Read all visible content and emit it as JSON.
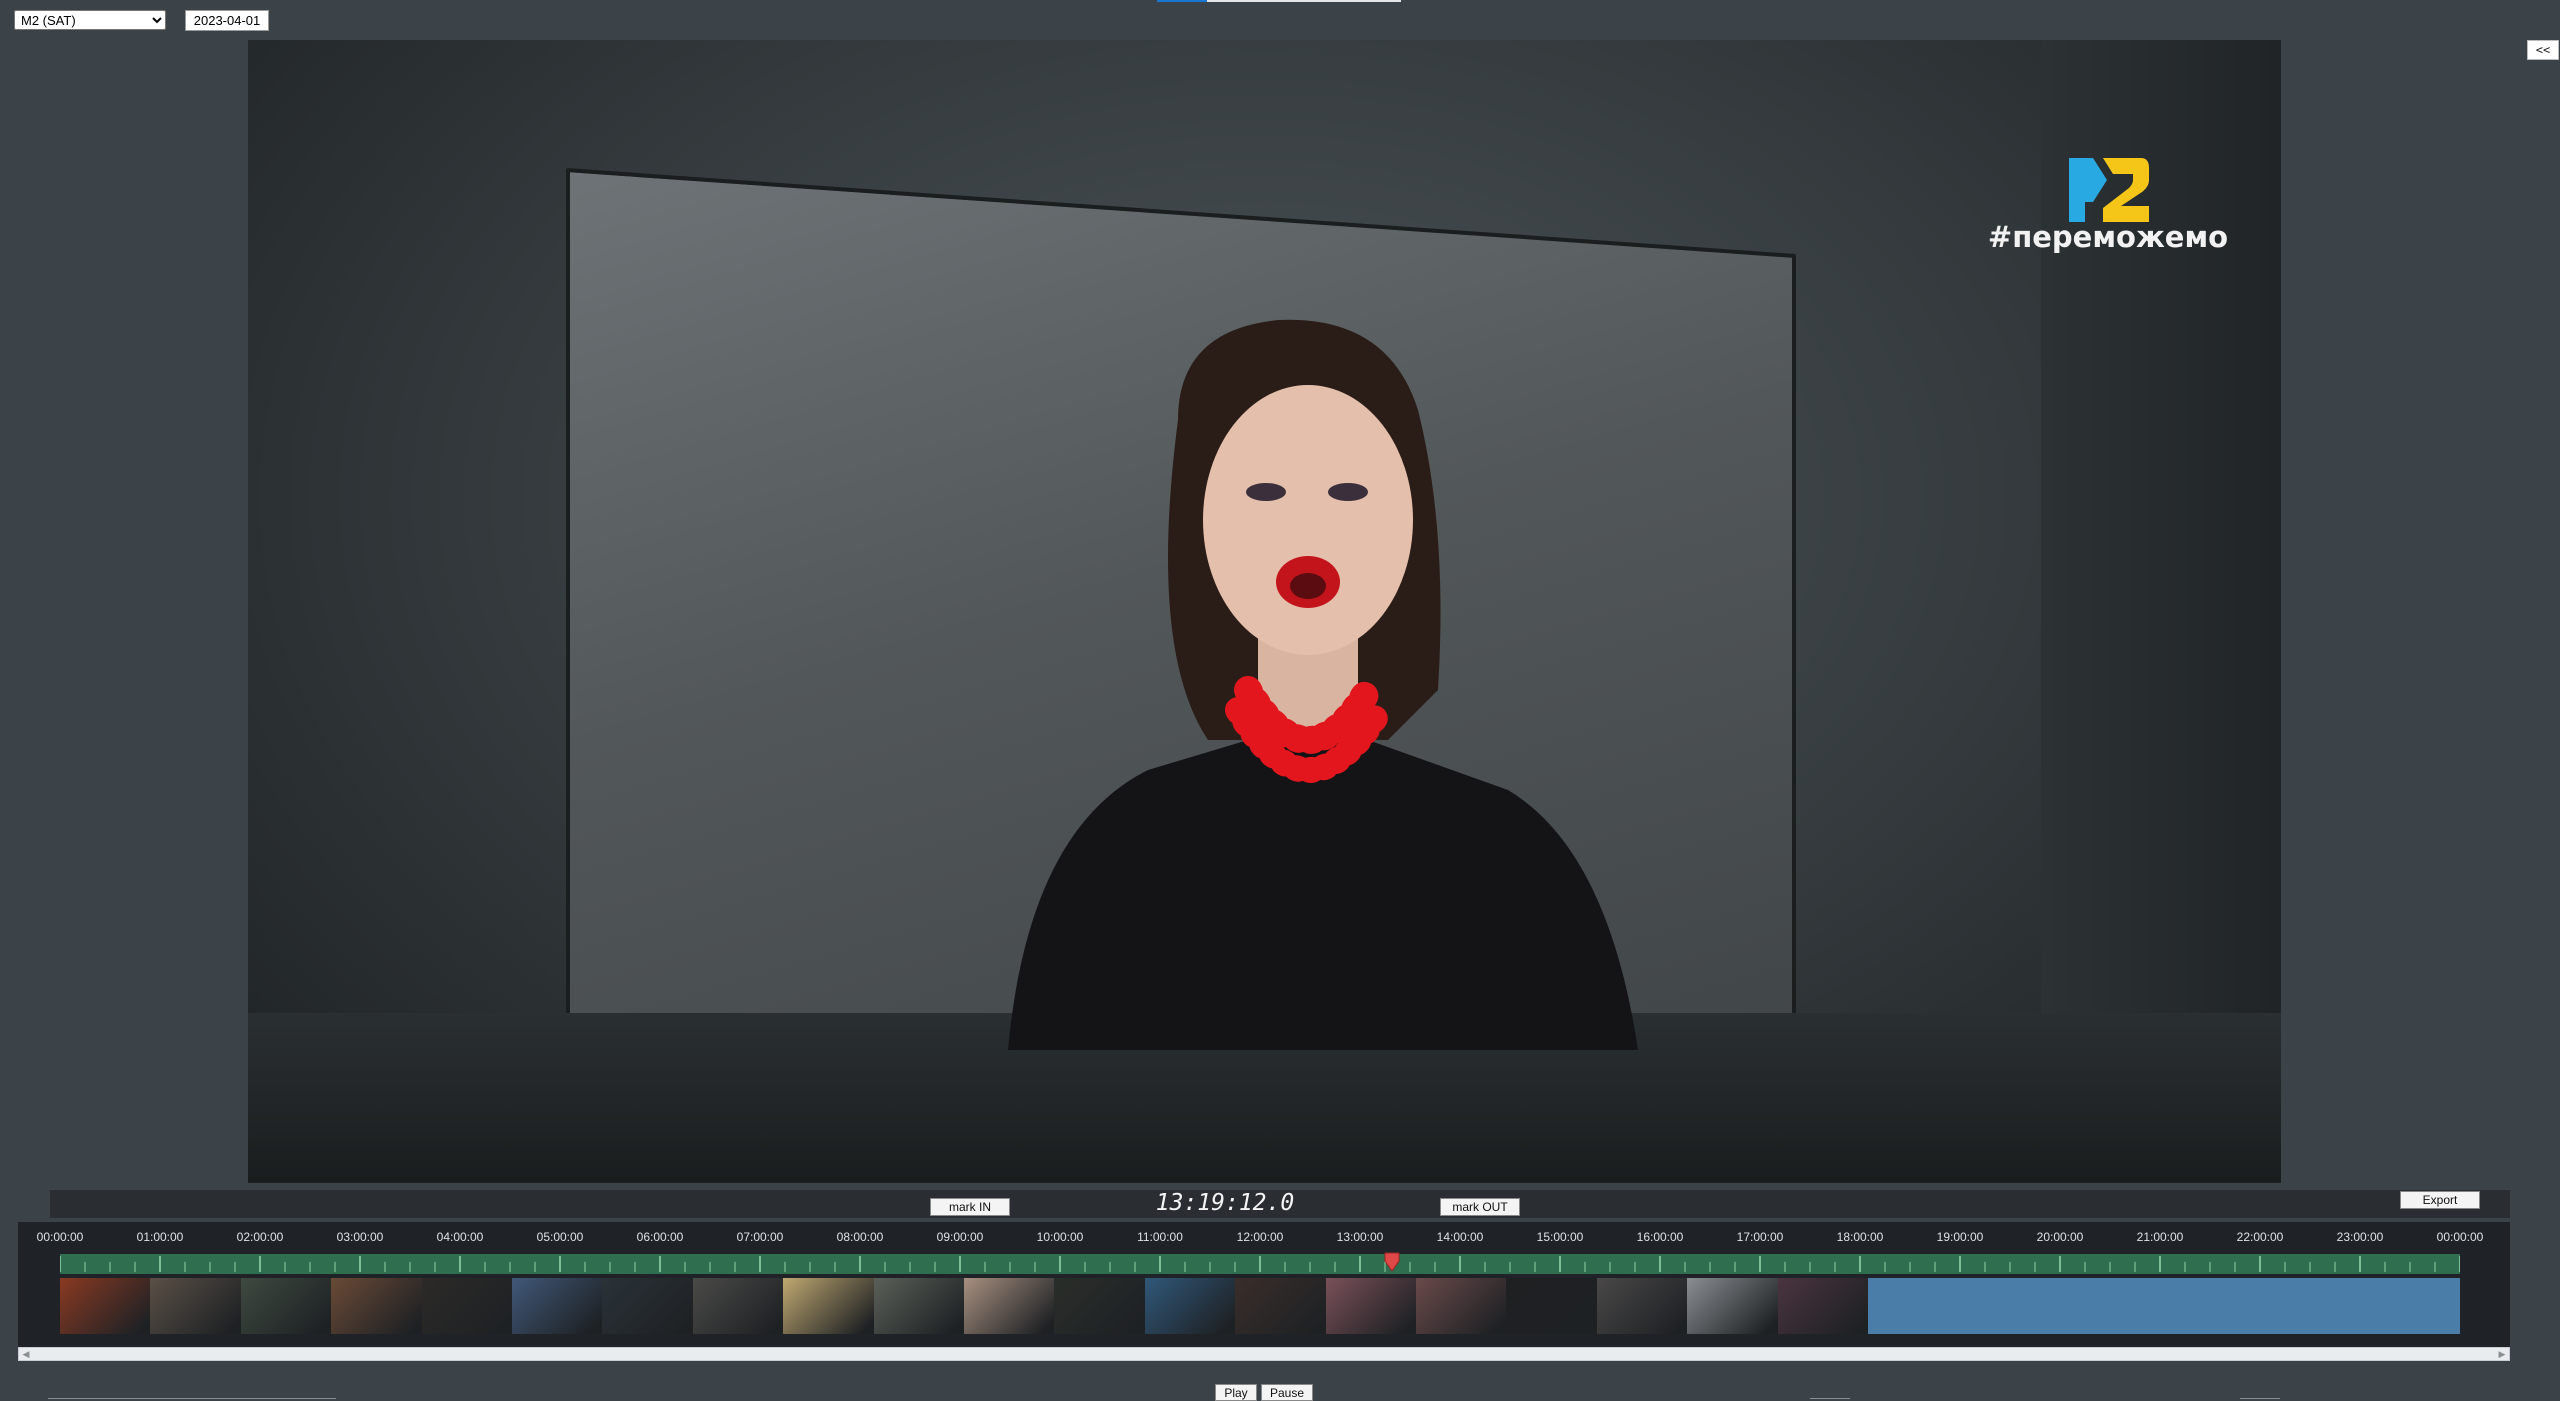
{
  "header": {
    "channel": "M2 (SAT)",
    "date": "2023-04-01",
    "collapse_label": "<<"
  },
  "video": {
    "overlay_hashtag": "#переможемо",
    "logo_icon": "m2-channel-logo",
    "colors": {
      "logo_blue": "#29a9e1",
      "logo_yellow": "#f5c518",
      "necklace_red": "#e3161e"
    }
  },
  "controls": {
    "mark_in": "mark IN",
    "mark_out": "mark OUT",
    "timecode": "13:19:12.0",
    "export": "Export",
    "play": "Play",
    "pause": "Pause"
  },
  "timeline": {
    "hour_labels": [
      "00:00:00",
      "01:00:00",
      "02:00:00",
      "03:00:00",
      "04:00:00",
      "05:00:00",
      "06:00:00",
      "07:00:00",
      "08:00:00",
      "09:00:00",
      "10:00:00",
      "11:00:00",
      "12:00:00",
      "13:00:00",
      "14:00:00",
      "15:00:00",
      "16:00:00",
      "17:00:00",
      "18:00:00",
      "19:00:00",
      "20:00:00",
      "21:00:00",
      "22:00:00",
      "23:00:00",
      "00:00:00"
    ],
    "playhead_hours": 13.32,
    "recorded_until_hours": 18.08,
    "colors": {
      "track": "#2f6e4e",
      "tick": "#8fd3a8",
      "playhead": "#e04848",
      "recorded": "#4a7ea8"
    },
    "thumbnail_colors": [
      "#8a3a22",
      "#5a5046",
      "#3e4a40",
      "#6a4a36",
      "#2c2a28",
      "#405878",
      "#2a3238",
      "#4a4a48",
      "#c0a870",
      "#5a6058",
      "#a89080",
      "#2a2e2a",
      "#30587a",
      "#3a2e2a",
      "#7a5058",
      "#6a4a4a",
      "#1e2022",
      "#4a4848",
      "#8a8e92",
      "#4a3440"
    ]
  }
}
